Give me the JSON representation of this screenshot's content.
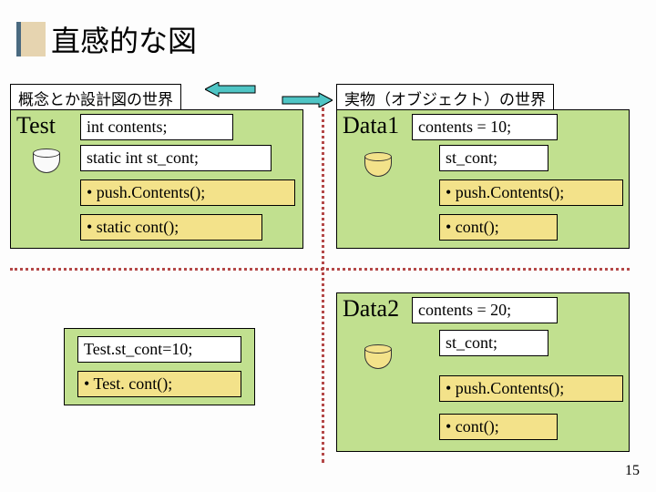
{
  "title": "直感的な図",
  "labels": {
    "left": "概念とか設計図の世界",
    "right": "実物（オブジェクト）の世界"
  },
  "test": {
    "name": "Test",
    "r1": "int contents;",
    "r2": "static int st_cont;",
    "r3": "•   push.Contents();",
    "r4": "•   static cont();"
  },
  "data1": {
    "name": "Data1",
    "r1": "contents = 10;",
    "r2": "st_cont;",
    "r3": "•   push.Contents();",
    "r4": "•   cont();"
  },
  "data2": {
    "name": "Data2",
    "r1": "contents = 20;",
    "r2": "st_cont;",
    "r3": "•   push.Contents();",
    "r4": "•   cont();"
  },
  "mid": {
    "r1": "Test.st_cont=10;",
    "r2": "•   Test. cont();"
  },
  "pagenum": "15"
}
